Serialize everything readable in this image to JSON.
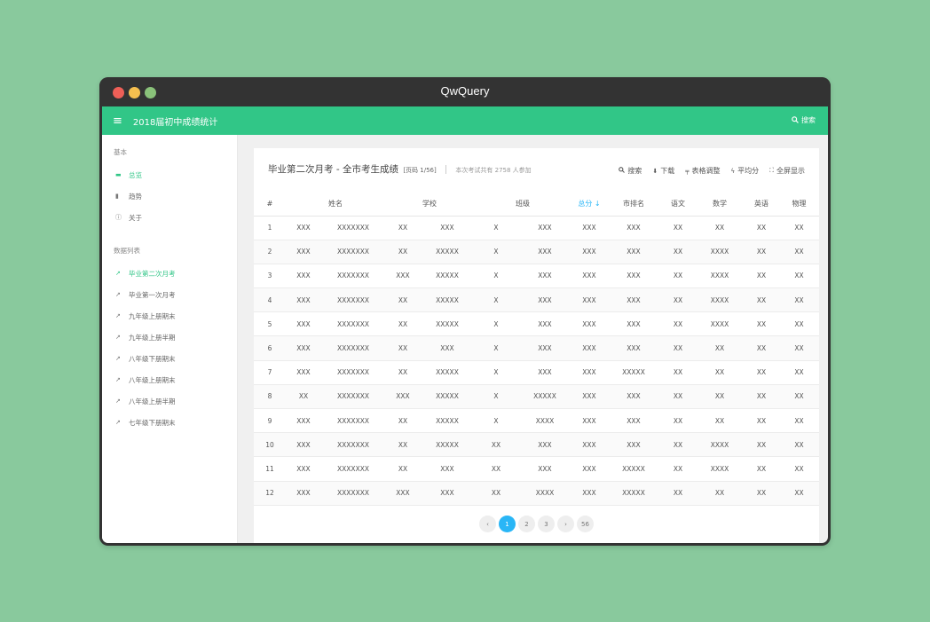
{
  "window": {
    "title": "QwQuery"
  },
  "appbar": {
    "menu_icon": "hamburger-menu-icon",
    "title": "2018届初中成绩统计",
    "search_label": "搜索"
  },
  "sidebar": {
    "section1": "基本",
    "basic_items": [
      {
        "label": "总览",
        "icon": "overview-icon",
        "active": true
      },
      {
        "label": "趋势",
        "icon": "bar-chart-icon",
        "active": false
      },
      {
        "label": "关于",
        "icon": "info-icon",
        "active": false
      }
    ],
    "section2": "数据列表",
    "data_items": [
      {
        "label": "毕业第二次月考",
        "icon": "trend-icon",
        "active": true
      },
      {
        "label": "毕业第一次月考",
        "icon": "trend-icon",
        "active": false
      },
      {
        "label": "九年级上册期末",
        "icon": "trend-icon",
        "active": false
      },
      {
        "label": "九年级上册半期",
        "icon": "trend-icon",
        "active": false
      },
      {
        "label": "八年级下册期末",
        "icon": "trend-icon",
        "active": false
      },
      {
        "label": "八年级上册期末",
        "icon": "trend-icon",
        "active": false
      },
      {
        "label": "八年级上册半期",
        "icon": "trend-icon",
        "active": false
      },
      {
        "label": "七年级下册期末",
        "icon": "trend-icon",
        "active": false
      }
    ]
  },
  "main": {
    "title": "毕业第二次月考 - 全市考生成绩",
    "page_indicator": "[页码 1/56]",
    "subtitle": "本次考试共有 2758 人参加",
    "actions": [
      {
        "label": "搜索",
        "icon": "search-icon"
      },
      {
        "label": "下载",
        "icon": "download-icon"
      },
      {
        "label": "表格调整",
        "icon": "paint-roller-icon"
      },
      {
        "label": "平均分",
        "icon": "lightning-icon"
      },
      {
        "label": "全屏显示",
        "icon": "fullscreen-icon"
      }
    ],
    "table": {
      "headers": [
        "#",
        "姓名",
        "学校",
        "班级",
        "总分 ↓",
        "市排名",
        "语文",
        "数学",
        "英语",
        "物理"
      ],
      "rows": [
        [
          "1",
          "XXX",
          "XXXXXXX",
          "XX",
          "XXX",
          "X",
          "XXX",
          "XXX",
          "XXX",
          "XX",
          "XX",
          "XX",
          "XX"
        ],
        [
          "2",
          "XXX",
          "XXXXXXX",
          "XX",
          "XXXXX",
          "X",
          "XXX",
          "XXX",
          "XXX",
          "XX",
          "XXXX",
          "XX",
          "XX"
        ],
        [
          "3",
          "XXX",
          "XXXXXXX",
          "XXX",
          "XXXXX",
          "X",
          "XXX",
          "XXX",
          "XXX",
          "XX",
          "XXXX",
          "XX",
          "XX"
        ],
        [
          "4",
          "XXX",
          "XXXXXXX",
          "XX",
          "XXXXX",
          "X",
          "XXX",
          "XXX",
          "XXX",
          "XX",
          "XXXX",
          "XX",
          "XX"
        ],
        [
          "5",
          "XXX",
          "XXXXXXX",
          "XX",
          "XXXXX",
          "X",
          "XXX",
          "XXX",
          "XXX",
          "XX",
          "XXXX",
          "XX",
          "XX"
        ],
        [
          "6",
          "XXX",
          "XXXXXXX",
          "XX",
          "XXX",
          "X",
          "XXX",
          "XXX",
          "XXX",
          "XX",
          "XX",
          "XX",
          "XX"
        ],
        [
          "7",
          "XXX",
          "XXXXXXX",
          "XX",
          "XXXXX",
          "X",
          "XXX",
          "XXX",
          "XXXXX",
          "XX",
          "XX",
          "XX",
          "XX"
        ],
        [
          "8",
          "XX",
          "XXXXXXX",
          "XXX",
          "XXXXX",
          "X",
          "XXXXX",
          "XXX",
          "XXX",
          "XX",
          "XX",
          "XX",
          "XX"
        ],
        [
          "9",
          "XXX",
          "XXXXXXX",
          "XX",
          "XXXXX",
          "X",
          "XXXX",
          "XXX",
          "XXX",
          "XX",
          "XX",
          "XX",
          "XX"
        ],
        [
          "10",
          "XXX",
          "XXXXXXX",
          "XX",
          "XXXXX",
          "XX",
          "XXX",
          "XXX",
          "XXX",
          "XX",
          "XXXX",
          "XX",
          "XX"
        ],
        [
          "11",
          "XXX",
          "XXXXXXX",
          "XX",
          "XXX",
          "XX",
          "XXX",
          "XXX",
          "XXXXX",
          "XX",
          "XXXX",
          "XX",
          "XX"
        ],
        [
          "12",
          "XXX",
          "XXXXXXX",
          "XXX",
          "XXX",
          "XX",
          "XXXX",
          "XXX",
          "XXXXX",
          "XX",
          "XX",
          "XX",
          "XX"
        ]
      ]
    },
    "pagination": {
      "prev": "‹",
      "pages": [
        "1",
        "2",
        "3"
      ],
      "next": "›",
      "last": "56",
      "current": "1"
    }
  },
  "colors": {
    "accent": "#31c687",
    "sorted": "#29b6f6",
    "page_bg": "#89c99d"
  }
}
